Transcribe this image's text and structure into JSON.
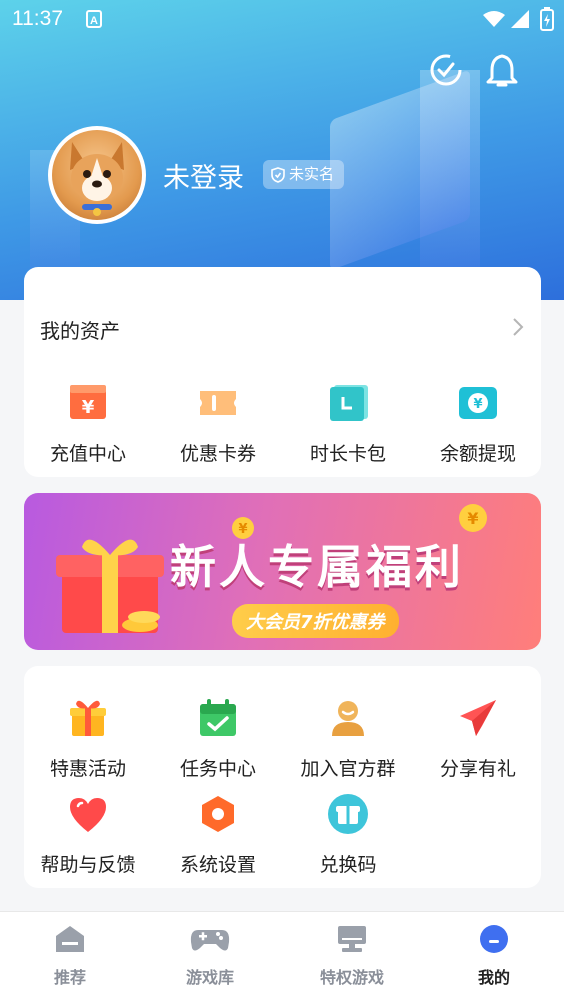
{
  "status_bar": {
    "time": "11:37"
  },
  "profile": {
    "username": "未登录",
    "verify_badge": "未实名"
  },
  "assets": {
    "title": "我的资产",
    "items": [
      {
        "label": "充值中心",
        "icon": "recharge-icon"
      },
      {
        "label": "优惠卡券",
        "icon": "coupon-icon"
      },
      {
        "label": "时长卡包",
        "icon": "time-card-icon"
      },
      {
        "label": "余额提现",
        "icon": "withdraw-icon"
      }
    ]
  },
  "banner": {
    "title": "新人专属福利",
    "subtitle": "大会员7折优惠券"
  },
  "services": {
    "items": [
      {
        "label": "特惠活动",
        "icon": "gift-box-icon"
      },
      {
        "label": "任务中心",
        "icon": "calendar-check-icon"
      },
      {
        "label": "加入官方群",
        "icon": "group-icon"
      },
      {
        "label": "分享有礼",
        "icon": "paper-plane-icon"
      },
      {
        "label": "帮助与反馈",
        "icon": "heart-icon"
      },
      {
        "label": "系统设置",
        "icon": "settings-hexagon-icon"
      },
      {
        "label": "兑换码",
        "icon": "redeem-gift-icon"
      }
    ]
  },
  "tabbar": {
    "tabs": [
      {
        "label": "推荐",
        "icon": "home-icon"
      },
      {
        "label": "游戏库",
        "icon": "gamepad-icon"
      },
      {
        "label": "特权游戏",
        "icon": "monitor-icon"
      },
      {
        "label": "我的",
        "icon": "profile-icon",
        "active": true
      }
    ]
  },
  "colors": {
    "accent": "#3f6ff0",
    "header_top": "#5dd2ea",
    "header_bottom": "#2d6fdc"
  }
}
